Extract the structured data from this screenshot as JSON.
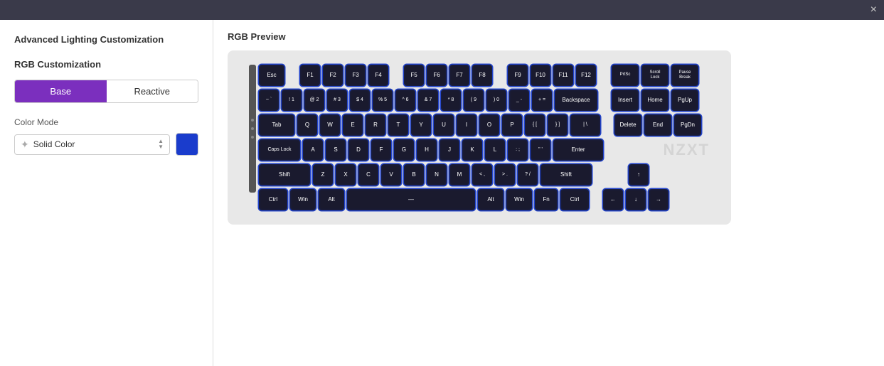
{
  "titleBar": {
    "closeLabel": "×"
  },
  "pageTitle": "Advanced Lighting Customization",
  "leftPanel": {
    "sectionTitle": "RGB Customization",
    "tabs": [
      {
        "id": "base",
        "label": "Base",
        "active": true
      },
      {
        "id": "reactive",
        "label": "Reactive",
        "active": false
      }
    ],
    "colorModeLabel": "Color Mode",
    "colorModeValue": "Solid Color",
    "colorSwatchColor": "#1a3ccc"
  },
  "rightPanel": {
    "sectionTitle": "RGB Preview",
    "nzxtBrand": "NZXT",
    "keyboard": {
      "rows": [
        {
          "keys": [
            {
              "label": "Esc",
              "class": "key-esc"
            },
            {
              "gap": "gap-small"
            },
            {
              "label": "F1",
              "class": "key-f1"
            },
            {
              "label": "F2",
              "class": "key-f2"
            },
            {
              "label": "F3",
              "class": "key-f3"
            },
            {
              "label": "F4",
              "class": "key-f4"
            },
            {
              "gap": "gap-small"
            },
            {
              "label": "F5",
              "class": "key-f5"
            },
            {
              "label": "F6",
              "class": "key-f6"
            },
            {
              "label": "F7",
              "class": "key-f7"
            },
            {
              "label": "F8",
              "class": "key-f8"
            },
            {
              "gap": "gap-small"
            },
            {
              "label": "F9",
              "class": "key-f9"
            },
            {
              "label": "F10",
              "class": "key-f10"
            },
            {
              "label": "F11",
              "class": "key-f11"
            },
            {
              "label": "F12",
              "class": "key-f12"
            },
            {
              "gap": "gap-small"
            },
            {
              "label": "PrtSc",
              "class": "key-prtsc"
            },
            {
              "label": "Scroll Lock",
              "class": "key-scroll"
            },
            {
              "label": "Pause Break",
              "class": "key-pause"
            }
          ]
        }
      ]
    }
  },
  "icons": {
    "sun": "✦",
    "spinnerUp": "▲",
    "spinnerDown": "▼"
  }
}
